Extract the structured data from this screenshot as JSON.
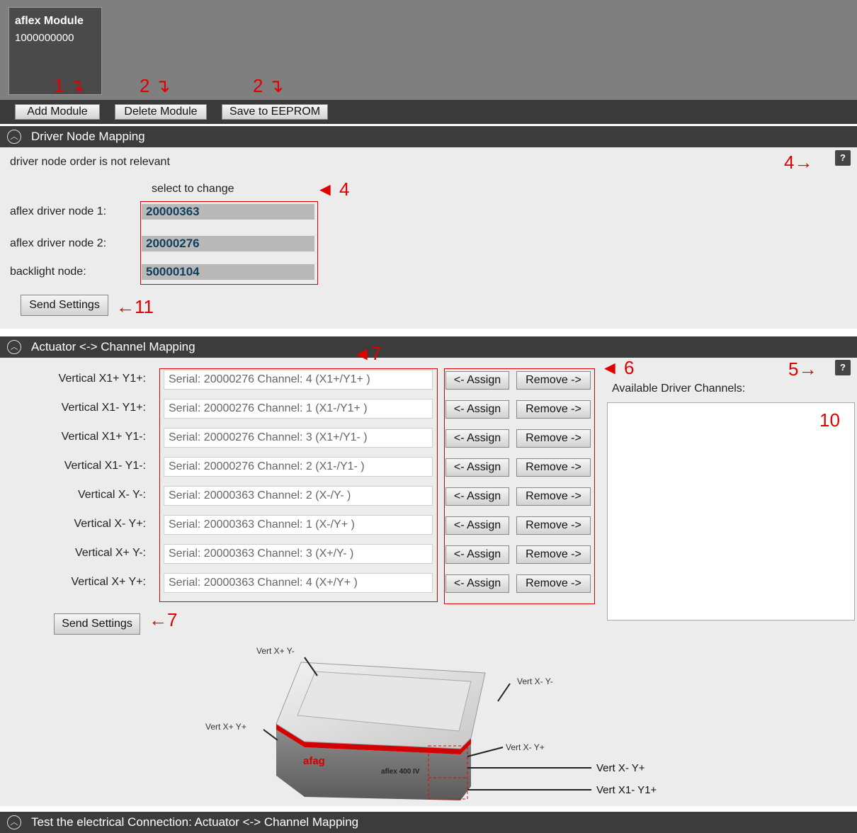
{
  "module": {
    "title": "aflex Module",
    "serial": "1000000000"
  },
  "toolbar": {
    "add_label": "Add Module",
    "delete_label": "Delete Module",
    "save_label": "Save to EEPROM"
  },
  "annotations": {
    "a1": "1",
    "a2": "2",
    "a3": "2",
    "a4a": "4",
    "a4b": "4",
    "a11": "11",
    "a7a": "7",
    "a6": "6",
    "a5": "5",
    "a10": "10",
    "a7b": "7"
  },
  "driver_section": {
    "title": "Driver Node Mapping",
    "note": "driver node order is not relevant",
    "select_hint": "select to change",
    "help": "?",
    "nodes": [
      {
        "label": "aflex driver node 1:",
        "value": "20000363"
      },
      {
        "label": "aflex driver node 2:",
        "value": "20000276"
      },
      {
        "label": "backlight node:",
        "value": "50000104"
      }
    ],
    "send_label": "Send Settings"
  },
  "actuator_section": {
    "title": "Actuator <-> Channel Mapping",
    "help": "?",
    "available_label": "Available Driver Channels:",
    "assign_label": "<- Assign",
    "remove_label": "Remove ->",
    "send_label": "Send Settings",
    "rows": [
      {
        "label": "Vertical X1+ Y1+:",
        "channel": "Serial: 20000276  Channel: 4 (X1+/Y1+        )"
      },
      {
        "label": "Vertical X1- Y1+:",
        "channel": "Serial: 20000276  Channel: 1 (X1-/Y1+        )"
      },
      {
        "label": "Vertical X1+ Y1-:",
        "channel": "Serial: 20000276  Channel: 3 (X1+/Y1-        )"
      },
      {
        "label": "Vertical X1- Y1-:",
        "channel": "Serial: 20000276  Channel: 2 (X1-/Y1-        )"
      },
      {
        "label": "Vertical X- Y-:",
        "channel": "Serial: 20000363  Channel: 2 (X-/Y-          )"
      },
      {
        "label": "Vertical X- Y+:",
        "channel": "Serial: 20000363  Channel: 1 (X-/Y+          )"
      },
      {
        "label": "Vertical X+ Y-:",
        "channel": "Serial: 20000363  Channel: 3 (X+/Y-          )"
      },
      {
        "label": "Vertical X+ Y+:",
        "channel": "Serial: 20000363  Channel: 4 (X+/Y+          )"
      }
    ]
  },
  "diagram": {
    "l1": "Vert X+ Y-",
    "l2": "Vert X- Y-",
    "l3": "Vert X+ Y+",
    "l4": "Vert X- Y+",
    "l5": "Vert X- Y+",
    "l6": "Vert X1- Y1+",
    "brand": "afag",
    "model": "aflex 400 IV"
  },
  "test_section": {
    "title": "Test the electrical Connection: Actuator <-> Channel Mapping"
  }
}
